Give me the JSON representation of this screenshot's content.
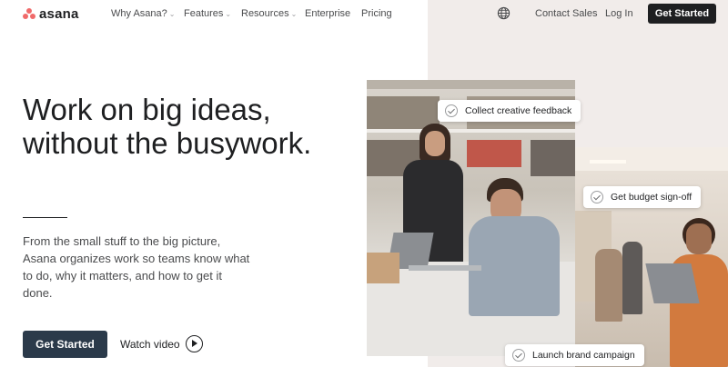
{
  "nav": {
    "logo_text": "asana",
    "items": [
      {
        "label": "Why Asana?",
        "has_dropdown": true
      },
      {
        "label": "Features",
        "has_dropdown": true
      },
      {
        "label": "Resources",
        "has_dropdown": true
      },
      {
        "label": "Enterprise",
        "has_dropdown": false
      },
      {
        "label": "Pricing",
        "has_dropdown": false
      }
    ],
    "dropdown_glyph": "⌄",
    "contact_sales": "Contact Sales",
    "log_in": "Log In",
    "get_started": "Get Started",
    "language_icon": "globe-icon"
  },
  "hero": {
    "headline_line1": "Work on big ideas,",
    "headline_line2": "without the busywork.",
    "description": "From the small stuff to the big picture, Asana organizes work so teams know what to do, why it matters, and how to get it done.",
    "primary_cta": "Get Started",
    "secondary_cta": "Watch video"
  },
  "callouts": [
    {
      "label": "Collect creative feedback"
    },
    {
      "label": "Get budget sign-off"
    },
    {
      "label": "Launch brand campaign"
    }
  ],
  "colors": {
    "brand_coral": "#f06a6a",
    "dark": "#1e1f21",
    "button_navy": "#2b3a4a",
    "right_panel_bg": "#f1ecea"
  }
}
